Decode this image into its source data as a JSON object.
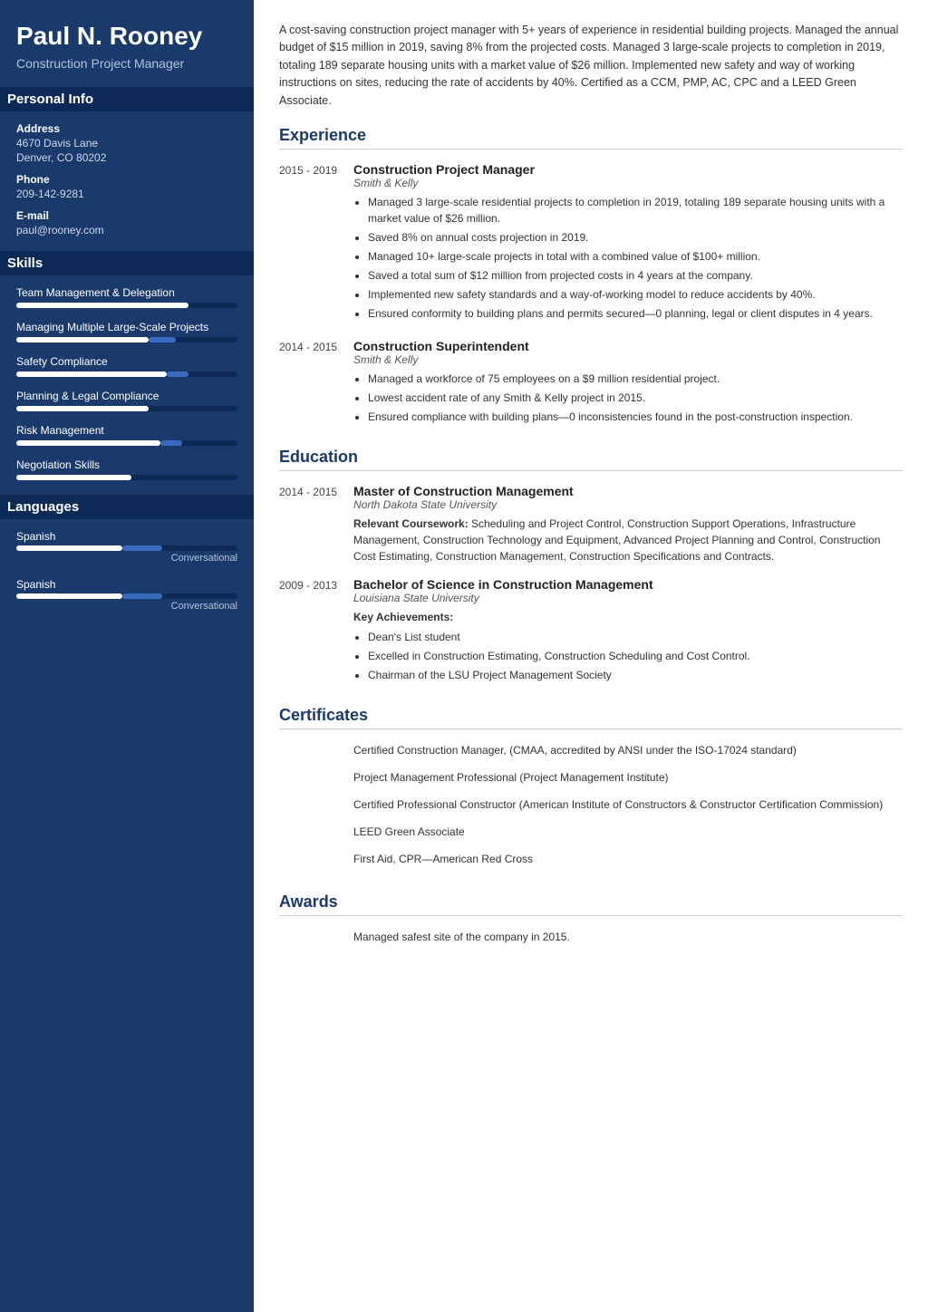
{
  "sidebar": {
    "name": "Paul N. Rooney",
    "title": "Construction Project Manager",
    "personal_info_label": "Personal Info",
    "address_label": "Address",
    "address_line1": "4670 Davis Lane",
    "address_line2": "Denver, CO 80202",
    "phone_label": "Phone",
    "phone_value": "209-142-9281",
    "email_label": "E-mail",
    "email_value": "paul@rooney.com",
    "skills_label": "Skills",
    "skills": [
      {
        "name": "Team Management & Delegation",
        "fill_pct": 78,
        "extra_pct": 0
      },
      {
        "name": "Managing Multiple Large-Scale Projects",
        "fill_pct": 60,
        "extra_pct": 12
      },
      {
        "name": "Safety Compliance",
        "fill_pct": 68,
        "extra_pct": 10
      },
      {
        "name": "Planning & Legal Compliance",
        "fill_pct": 60,
        "extra_pct": 0
      },
      {
        "name": "Risk Management",
        "fill_pct": 65,
        "extra_pct": 10
      },
      {
        "name": "Negotiation Skills",
        "fill_pct": 52,
        "extra_pct": 0
      }
    ],
    "languages_label": "Languages",
    "languages": [
      {
        "name": "Spanish",
        "fill_pct": 48,
        "extra_pct": 18,
        "level": "Conversational"
      },
      {
        "name": "Spanish",
        "fill_pct": 48,
        "extra_pct": 18,
        "level": "Conversational"
      }
    ]
  },
  "main": {
    "summary": "A cost-saving construction project manager with 5+ years of experience in residential building projects. Managed the annual budget of $15 million in 2019, saving 8% from the projected costs. Managed 3 large-scale projects to completion in 2019, totaling 189 separate housing units with a market value of $26 million. Implemented new safety and way of working instructions on sites, reducing the rate of accidents by 40%. Certified as a CCM, PMP, AC, CPC and a LEED Green Associate.",
    "experience_label": "Experience",
    "experiences": [
      {
        "dates": "2015 - 2019",
        "title": "Construction Project Manager",
        "company": "Smith & Kelly",
        "bullets": [
          "Managed 3 large-scale residential projects to completion in 2019, totaling 189 separate housing units with a market value of $26 million.",
          "Saved 8% on annual costs projection in 2019.",
          "Managed 10+ large-scale projects in total with a combined value of $100+ million.",
          "Saved a total sum of $12 million from projected costs in 4 years at the company.",
          "Implemented new safety standards and a way-of-working model to reduce accidents by 40%.",
          "Ensured conformity to building plans and permits secured—0 planning, legal or client disputes in 4 years."
        ]
      },
      {
        "dates": "2014 - 2015",
        "title": "Construction Superintendent",
        "company": "Smith & Kelly",
        "bullets": [
          "Managed a workforce of 75 employees on a $9 million residential project.",
          "Lowest accident rate of any Smith & Kelly project in 2015.",
          "Ensured compliance with building plans—0 inconsistencies found in the post-construction inspection."
        ]
      }
    ],
    "education_label": "Education",
    "educations": [
      {
        "dates": "2014 - 2015",
        "degree": "Master of Construction Management",
        "school": "North Dakota State University",
        "coursework_label": "Relevant Coursework:",
        "coursework": "Scheduling and Project Control, Construction Support Operations, Infrastructure Management, Construction Technology and Equipment, Advanced Project Planning and Control, Construction Cost Estimating, Construction Management, Construction Specifications and Contracts.",
        "achievements_label": "",
        "achievements": []
      },
      {
        "dates": "2009 - 2013",
        "degree": "Bachelor of Science in Construction Management",
        "school": "Louisiana State University",
        "coursework_label": "",
        "coursework": "",
        "achievements_label": "Key Achievements:",
        "achievements": [
          "Dean's List student",
          "Excelled in Construction Estimating, Construction Scheduling and Cost Control.",
          "Chairman of the LSU Project Management Society"
        ]
      }
    ],
    "certificates_label": "Certificates",
    "certificates": [
      "Certified Construction Manager, (CMAA, accredited by ANSI under the ISO-17024 standard)",
      "Project Management Professional (Project Management Institute)",
      "Certified Professional Constructor (American Institute of Constructors & Constructor Certification Commission)",
      "LEED Green Associate",
      "First Aid, CPR—American Red Cross"
    ],
    "awards_label": "Awards",
    "awards": [
      "Managed safest site of the company in 2015."
    ]
  }
}
